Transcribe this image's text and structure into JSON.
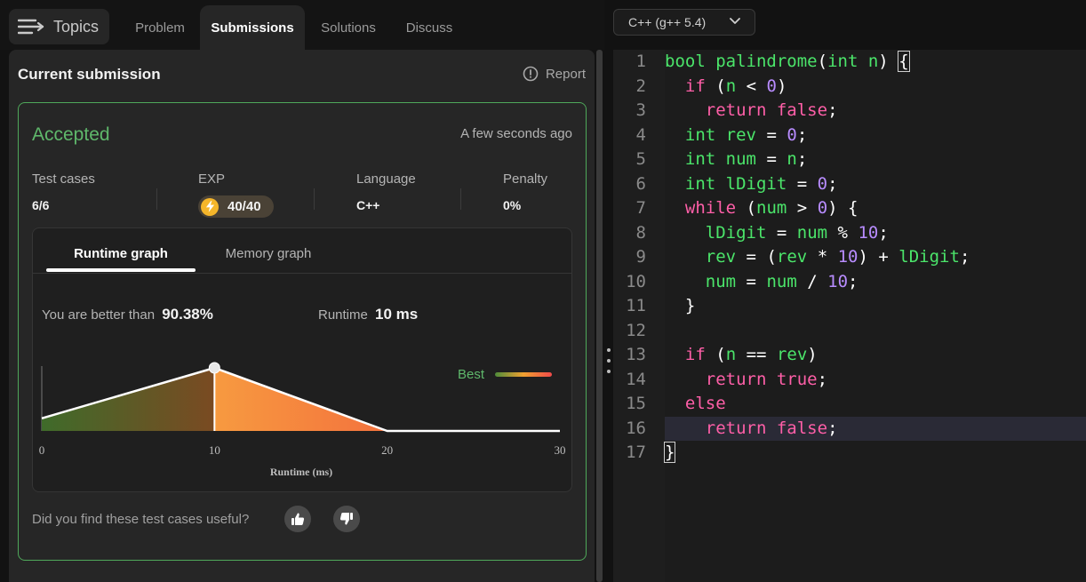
{
  "nav": {
    "topics_label": "Topics",
    "tabs": [
      {
        "label": "Problem"
      },
      {
        "label": "Submissions"
      },
      {
        "label": "Solutions"
      },
      {
        "label": "Discuss"
      }
    ]
  },
  "submission": {
    "title": "Current submission",
    "report_label": "Report",
    "status": "Accepted",
    "time_ago": "A few seconds ago",
    "stats": [
      {
        "label": "Test cases",
        "value": "6/6"
      },
      {
        "label": "EXP",
        "value": "40/40"
      },
      {
        "label": "Language",
        "value": "C++"
      },
      {
        "label": "Penalty",
        "value": "0%"
      }
    ],
    "graph_tabs": [
      {
        "label": "Runtime graph"
      },
      {
        "label": "Memory graph"
      }
    ],
    "better_label": "You are better than",
    "better_value": "90.38%",
    "runtime_label": "Runtime",
    "runtime_value": "10 ms",
    "feedback_question": "Did you find these test cases useful?"
  },
  "chart_data": {
    "type": "area",
    "x": [
      0,
      10,
      20,
      30
    ],
    "y": [
      0.2,
      1.0,
      0.0,
      0.0
    ],
    "marker_x": 10,
    "xlim": [
      0,
      30
    ],
    "xticks": [
      "0",
      "10",
      "20",
      "30"
    ],
    "xlabel": "Runtime (ms)",
    "legend": "Best",
    "legend_placement": "top-right",
    "colors": {
      "low": "#4e8c3a",
      "mid": "#f08a35",
      "high": "#f04a4a"
    }
  },
  "editor": {
    "language": "C++ (g++ 5.4)",
    "lines": [
      "bool palindrome(int n) {",
      "  if (n < 0)",
      "    return false;",
      "  int rev = 0;",
      "  int num = n;",
      "  int lDigit = 0;",
      "  while (num > 0) {",
      "    lDigit = num % 10;",
      "    rev = (rev * 10) + lDigit;",
      "    num = num / 10;",
      "  }",
      "",
      "  if (n == rev)",
      "    return true;",
      "  else",
      "    return false;",
      "}"
    ],
    "line_numbers": [
      "1",
      "2",
      "3",
      "4",
      "5",
      "6",
      "7",
      "8",
      "9",
      "10",
      "11",
      "12",
      "13",
      "14",
      "15",
      "16",
      "17"
    ],
    "highlighted_line": 16
  },
  "colors": {
    "accent_green": "#5fb86b",
    "keyword_pink": "#ff5fa8",
    "identifier_green": "#4be56a",
    "number_purple": "#b88cff"
  }
}
